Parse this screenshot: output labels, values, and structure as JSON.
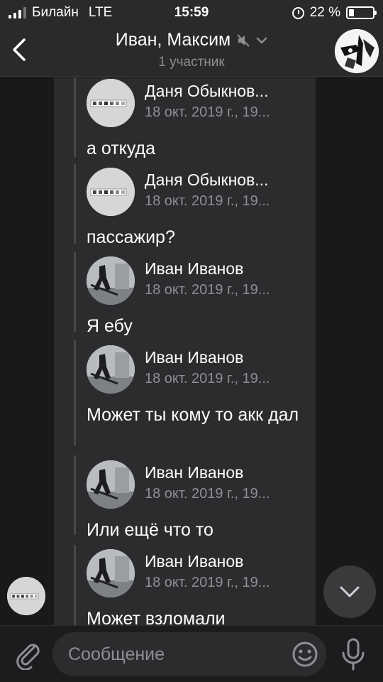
{
  "status_bar": {
    "carrier": "Билайн",
    "network": "LTE",
    "time": "15:59",
    "battery": "22 %",
    "battery_level": 0.22
  },
  "header": {
    "title": "Иван, Максим",
    "subtitle": "1 участник",
    "icons": [
      "back-icon",
      "mute-icon",
      "chevron-down-icon"
    ]
  },
  "messages": [
    {
      "sender": "Даня Обыкнов...",
      "date": "18 окт. 2019 г., 19...",
      "text": "а откуда"
    },
    {
      "sender": "Даня Обыкнов...",
      "date": "18 окт. 2019 г., 19...",
      "text": "пассажир?"
    },
    {
      "sender": "Иван Иванов",
      "date": "18 окт. 2019 г., 19...",
      "text": "Я ебу"
    },
    {
      "sender": "Иван Иванов",
      "date": "18 окт. 2019 г., 19...",
      "text": "Может ты кому то акк дал"
    },
    {
      "sender": "Иван Иванов",
      "date": "18 окт. 2019 г., 19...",
      "text": "Или ещё что то"
    },
    {
      "sender": "Иван Иванов",
      "date": "18 окт. 2019 г., 19...",
      "text": "Может взломали"
    }
  ],
  "composer": {
    "placeholder": "Сообщение",
    "icons": [
      "paperclip-icon",
      "emoji-icon",
      "microphone-icon"
    ]
  },
  "colors": {
    "background": "#19191a",
    "bubble": "#2c2c2e",
    "bar": "#2a2a2b",
    "secondary_text": "#8e8e93"
  }
}
